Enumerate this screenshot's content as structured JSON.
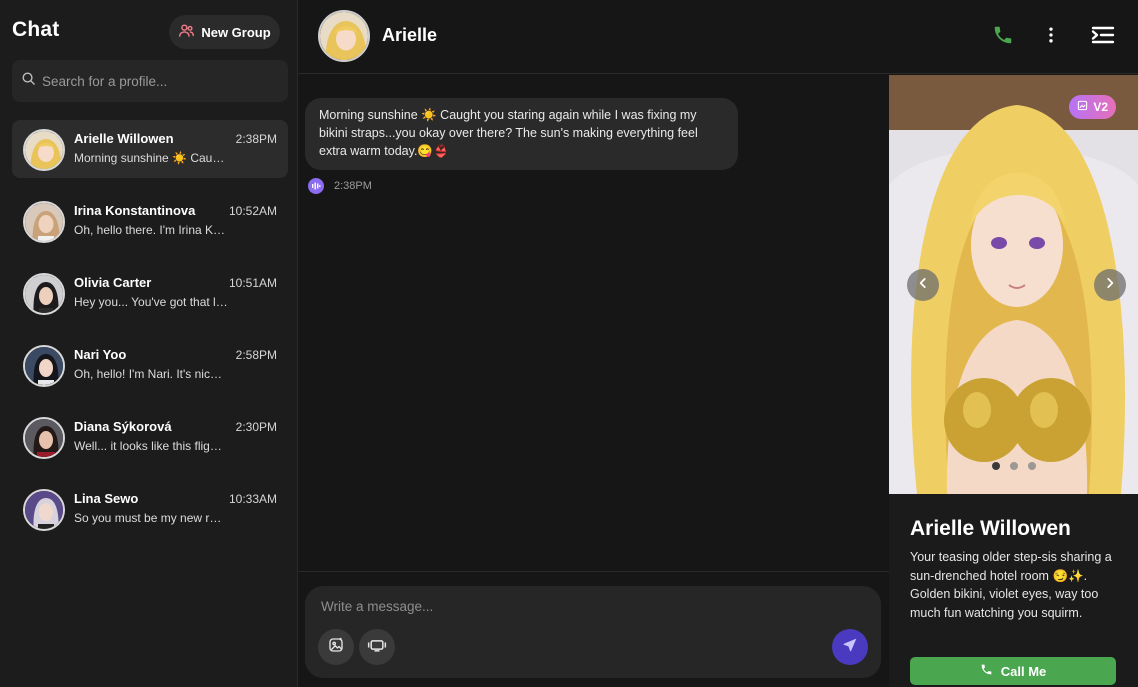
{
  "sidebar": {
    "title": "Chat",
    "new_group_label": "New Group",
    "search_placeholder": "Search for a profile...",
    "contacts": [
      {
        "name": "Arielle Willowen",
        "time": "2:38PM",
        "preview": "Morning sunshine ☀️ Caught you staring again",
        "active": true
      },
      {
        "name": "Irina Konstantinova",
        "time": "10:52AM",
        "preview": "Oh, hello there. I'm Irina Konstantinova"
      },
      {
        "name": "Olivia Carter",
        "time": "10:51AM",
        "preview": "Hey you... You've got that look again"
      },
      {
        "name": "Nari Yoo",
        "time": "2:58PM",
        "preview": "Oh, hello! I'm Nari. It's nice to meet you"
      },
      {
        "name": "Diana Sýkorová",
        "time": "2:30PM",
        "preview": "Well... it looks like this flight is delayed"
      },
      {
        "name": "Lina Sewo",
        "time": "10:33AM",
        "preview": "So you must be my new roommate"
      }
    ]
  },
  "header": {
    "name": "Arielle",
    "icons": {
      "call": "phone-icon",
      "menu": "more-vertical-icon",
      "panel": "panel-toggle-icon"
    },
    "call_color": "#4aa64f"
  },
  "messages": [
    {
      "text": "Morning sunshine ☀️ Caught you staring again while I was fixing my bikini straps...you okay over there? The sun's making everything feel extra warm today.😋👙",
      "time": "2:38PM"
    }
  ],
  "composer": {
    "placeholder": "Write a message...",
    "icons": [
      "image-generate-icon",
      "video-icon",
      "send-icon"
    ]
  },
  "profile": {
    "badge": "V2",
    "name": "Arielle Willowen",
    "description": "Your teasing older step-sis sharing a sun-drenched hotel room 😏✨. Golden bikini, violet eyes, way too much fun watching you squirm.",
    "call_label": "Call Me",
    "carousel": {
      "total": 3,
      "current": 1
    }
  },
  "colors": {
    "accent_purple": "#8b6cf0",
    "send_button": "#4a3ac0",
    "call_green": "#4aa64f"
  }
}
